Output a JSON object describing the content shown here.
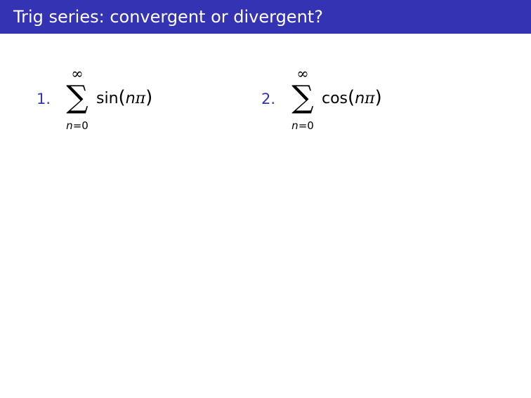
{
  "title": "Trig series: convergent or divergent?",
  "items": [
    {
      "number": "1.",
      "upper_limit": "∞",
      "sigma": "∑",
      "lower_var": "n",
      "lower_eq": "=0",
      "function": "sin",
      "open_paren": "(",
      "arg_var": "n",
      "arg_pi": "π",
      "close_paren": ")"
    },
    {
      "number": "2.",
      "upper_limit": "∞",
      "sigma": "∑",
      "lower_var": "n",
      "lower_eq": "=0",
      "function": "cos",
      "open_paren": "(",
      "arg_var": "n",
      "arg_pi": "π",
      "close_paren": ")"
    }
  ],
  "colors": {
    "title_bar": "#3333b3",
    "title_text": "#ffffff",
    "item_number": "#3333b3",
    "body_text": "#000000"
  }
}
